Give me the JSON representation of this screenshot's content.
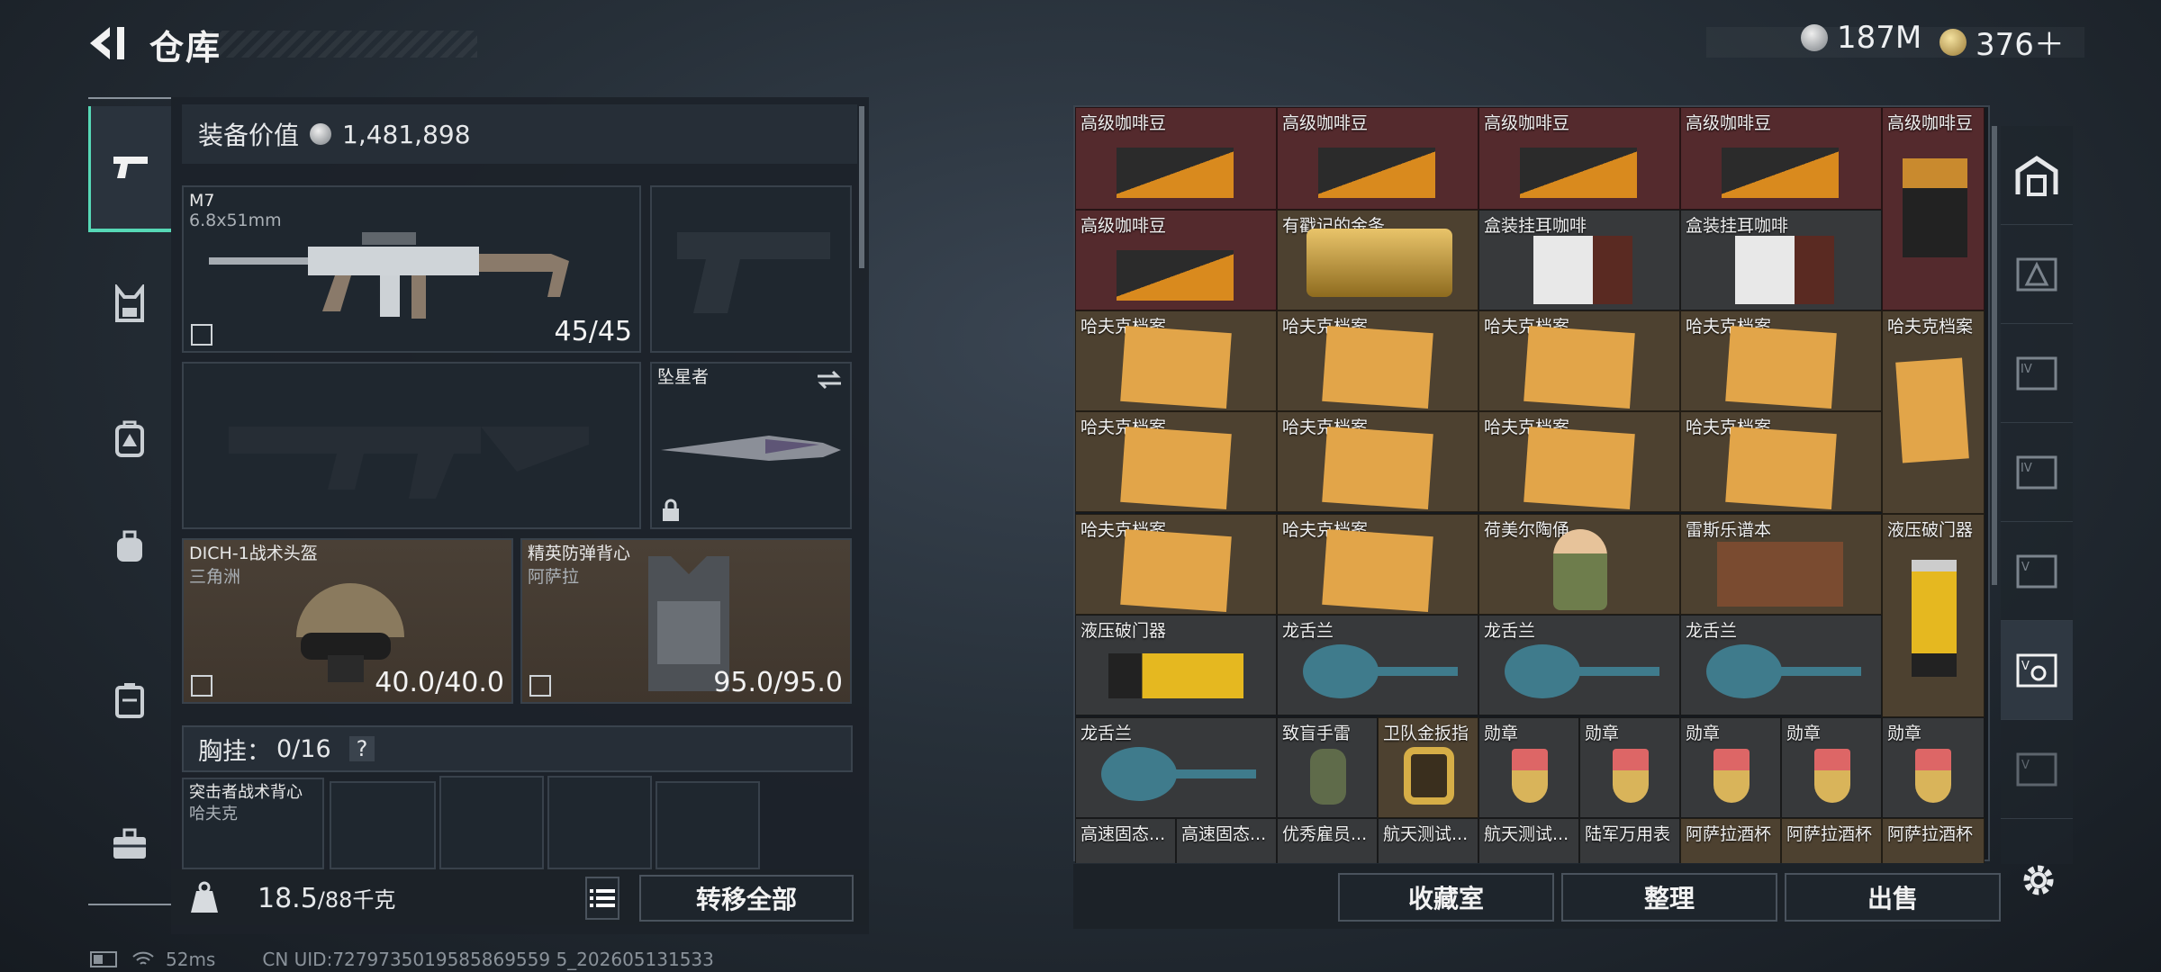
{
  "header": {
    "title": "仓库",
    "currency1": "187M",
    "currency2": "376＋"
  },
  "equipment": {
    "value_label": "装备价值",
    "value": "1,481,898",
    "primary": {
      "name": "M7",
      "ammo_type": "6.8x51mm",
      "ammo": "45/45"
    },
    "melee": {
      "name": "坠星者"
    },
    "helmet": {
      "name": "DICH-1战术头盔",
      "maker": "三角洲",
      "durability": "40.0/40.0"
    },
    "armor": {
      "name": "精英防弹背心",
      "maker": "阿萨拉",
      "durability": "95.0/95.0"
    },
    "chest": {
      "label": "胸挂：",
      "count": "0/16",
      "help": "?"
    },
    "rig": {
      "name": "突击者战术背心",
      "maker": "哈夫克"
    },
    "weight": {
      "current": "18.5",
      "max": "/88千克"
    },
    "transfer_all": "转移全部"
  },
  "storage": {
    "buttons": [
      "收藏室",
      "整理",
      "出售"
    ],
    "items": [
      "高级咖啡豆",
      "高级咖啡豆",
      "高级咖啡豆",
      "高级咖啡豆",
      "高级咖啡豆",
      "高级咖啡豆",
      "有戳记的金条",
      "盒装挂耳咖啡",
      "盒装挂耳咖啡",
      "哈夫克档案",
      "哈夫克档案",
      "哈夫克档案",
      "哈夫克档案",
      "哈夫克档案",
      "哈夫克档案",
      "哈夫克档案",
      "哈夫克档案",
      "哈夫克档案",
      "哈夫克档案",
      "哈夫克档案",
      "荷美尔陶俑",
      "雷斯乐谱本",
      "液压破门器",
      "液压破门器",
      "龙舌兰",
      "龙舌兰",
      "龙舌兰",
      "龙舌兰",
      "致盲手雷",
      "卫队金扳指",
      "勋章",
      "勋章",
      "勋章",
      "勋章",
      "勋章",
      "高速固态...",
      "高速固态...",
      "优秀雇员...",
      "航天测试...",
      "航天测试...",
      "陆军万用表",
      "阿萨拉酒杯",
      "阿萨拉酒杯",
      "阿萨拉酒杯"
    ]
  },
  "status": {
    "ping": "52ms",
    "uid": "CN UID:7279735019585869559 5_202605131533"
  },
  "colors": {
    "accent": "#56d8b6",
    "cellRed": "#542a2d",
    "cellGold": "#4d4130"
  }
}
